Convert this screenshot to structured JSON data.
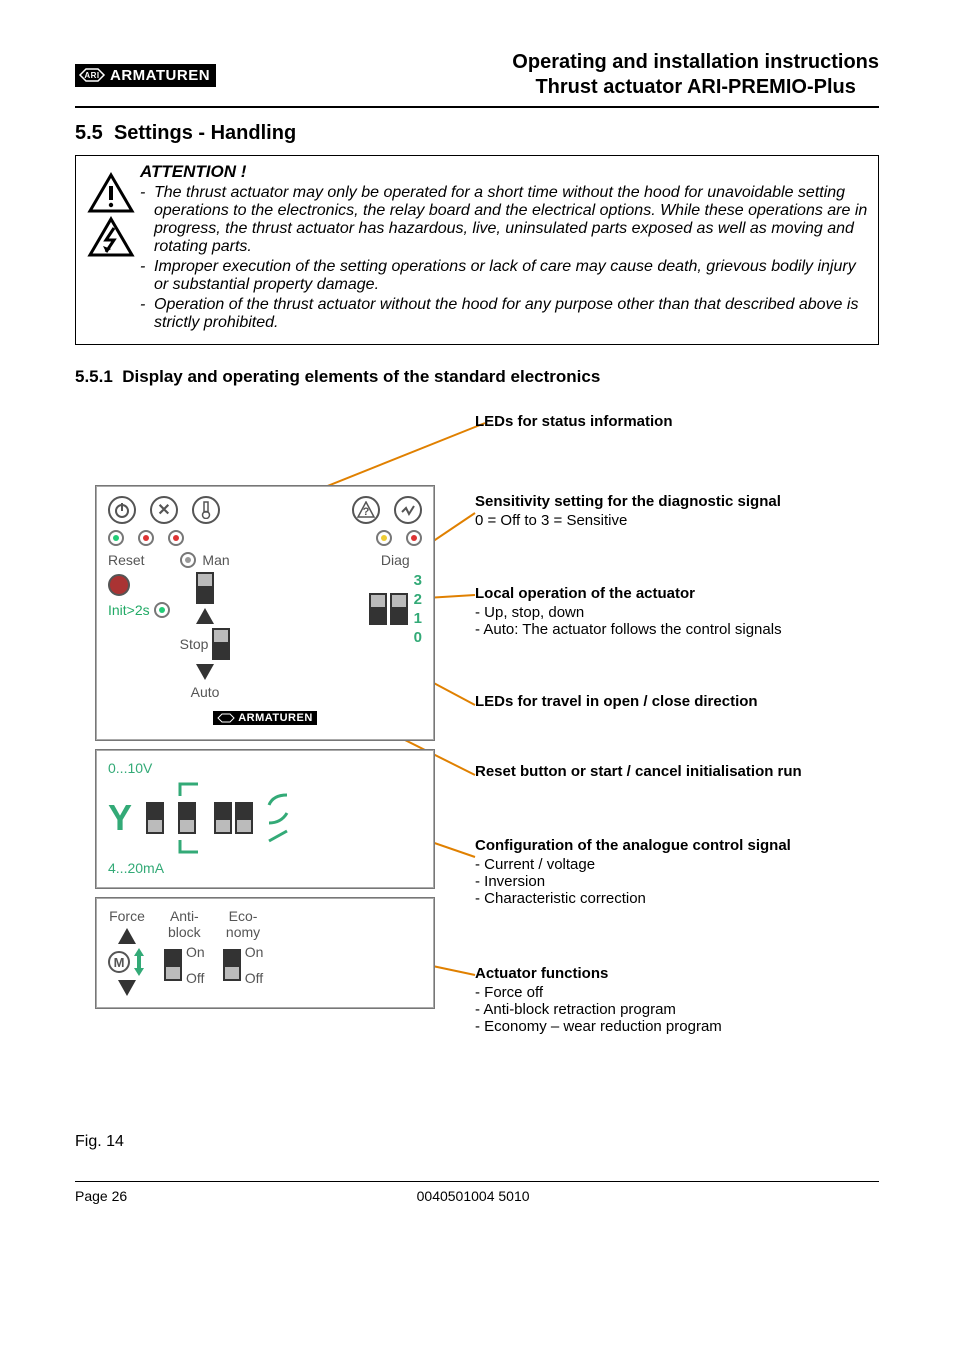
{
  "brand": "ARMATUREN",
  "header": {
    "line1": "Operating and installation instructions",
    "line2": "Thrust actuator ARI-PREMIO-Plus"
  },
  "section": {
    "number": "5.5",
    "title": "Settings - Handling"
  },
  "attention": {
    "title": "ATTENTION !",
    "items": [
      "The thrust actuator may only be operated for a short time without the hood for unavoidable setting operations to the electronics, the relay board and the electrical options. While these operations are in progress, the thrust actuator has hazardous, live, uninsulated parts exposed as well as moving and rotating parts.",
      "Improper execution of the setting operations or lack of care may cause death, grievous bodily injury or substantial property damage.",
      "Operation of the thrust actuator without the hood for any purpose other than that described above is strictly prohibited."
    ]
  },
  "subhead": {
    "number": "5.5.1",
    "title": "Display and operating elements of the standard electronics"
  },
  "panel": {
    "man": "Man",
    "diag": "Diag",
    "reset": "Reset",
    "stop": "Stop",
    "init": "Init>2s",
    "auto": "Auto",
    "nums": [
      "3",
      "2",
      "1",
      "0"
    ],
    "y": "Y",
    "v_label": "0...10V",
    "ma_label": "4...20mA",
    "force": "Force",
    "antiblock": "Anti-\nblock",
    "economy": "Eco-\nnomy",
    "on": "On",
    "off": "Off",
    "m": "M"
  },
  "callouts": {
    "leds_status": {
      "title": "LEDs for status information"
    },
    "sensitivity": {
      "title": "Sensitivity setting for the diagnostic signal",
      "body": "0 = Off to 3 = Sensitive"
    },
    "local_op": {
      "title": "Local operation of the actuator",
      "items": [
        "Up, stop, down",
        "Auto: The actuator follows the control signals"
      ]
    },
    "leds_travel": {
      "title": "LEDs for travel in open / close direction"
    },
    "reset_btn": {
      "title": "Reset button or start / cancel initialisation run"
    },
    "analogue": {
      "title": "Configuration of the analogue control signal",
      "items": [
        "Current / voltage",
        "Inversion",
        "Characteristic correction"
      ]
    },
    "actuator_fn": {
      "title": "Actuator functions",
      "items": [
        "Force off",
        "Anti-block retraction program",
        "Economy – wear reduction program"
      ]
    }
  },
  "figure": "Fig. 14",
  "footer": {
    "page": "Page 26",
    "doc": "0040501004 5010"
  }
}
